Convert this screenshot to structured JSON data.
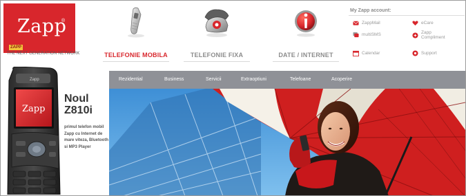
{
  "brand": {
    "logo": "Zapp",
    "badge": "ZAPP",
    "tagline": "THE NEXT GENERATION NETWORK",
    "primary_color": "#d8262c"
  },
  "nav": [
    {
      "label": "TELEFONIE MOBILA",
      "icon": "mobile-phone-icon",
      "active": true
    },
    {
      "label": "TELEFONIE FIXA",
      "icon": "desk-phone-icon",
      "active": false
    },
    {
      "label": "DATE / INTERNET",
      "icon": "info-icon",
      "active": false
    }
  ],
  "account": {
    "title": "My Zapp account:",
    "links": [
      {
        "label": "ZappMail",
        "icon": "mail-icon"
      },
      {
        "label": "eCare",
        "icon": "heart-icon"
      },
      {
        "label": "multiSMS",
        "icon": "sms-icon"
      },
      {
        "label": "Zapp Compliment",
        "icon": "compliment-icon"
      },
      {
        "label": "Calendar",
        "icon": "calendar-icon"
      },
      {
        "label": "Support",
        "icon": "support-icon"
      }
    ]
  },
  "promo": {
    "title_line1": "Noul",
    "title_line2": "Z810i",
    "description": "primul telefon mobil Zapp cu Internet de mare viteza, Bluetooth si MP3 Player",
    "phone_screen_logo": "Zapp"
  },
  "menu": {
    "items": [
      "Rezidential",
      "Business",
      "Servicii",
      "Extraoptiuni",
      "Telefoane",
      "Acoperire"
    ],
    "bar_color": "#8f9197"
  }
}
